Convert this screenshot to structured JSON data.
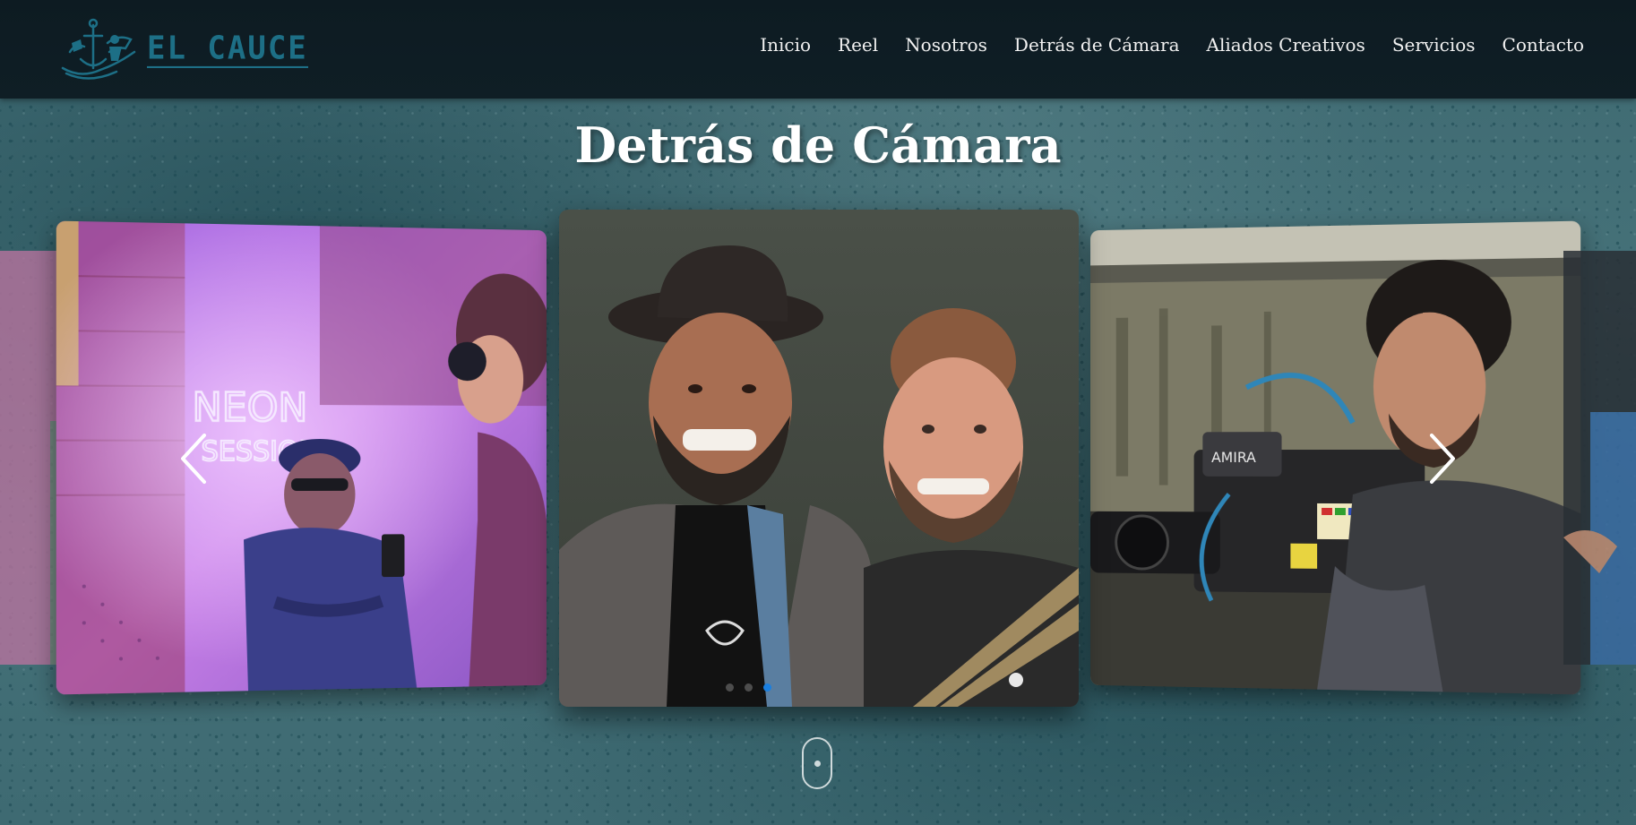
{
  "brand": {
    "name": "EL CAUCE",
    "logo_icon": "anchor-sailor-logo-icon"
  },
  "nav": {
    "items": [
      {
        "label": "Inicio"
      },
      {
        "label": "Reel"
      },
      {
        "label": "Nosotros"
      },
      {
        "label": "Detrás de Cámara"
      },
      {
        "label": "Aliados Creativos"
      },
      {
        "label": "Servicios"
      },
      {
        "label": "Contacto"
      }
    ]
  },
  "section": {
    "title": "Detrás de Cámara"
  },
  "carousel": {
    "slides": [
      {
        "name": "neon-sessions-photo",
        "neon_text_1": "NEON",
        "neon_text_2": "SESSIONS"
      },
      {
        "name": "two-men-smiling-photo"
      },
      {
        "name": "cameraman-photo",
        "camera_label": "AMIRA"
      }
    ],
    "dots_count": 3,
    "active_dot": 1,
    "prev_icon": "chevron-left-icon",
    "next_icon": "chevron-right-icon"
  },
  "colors": {
    "navbar_bg": "#0f1e25",
    "brand": "#1d6f86",
    "active_dot": "#1a7fe0",
    "page_bg": "#46737a"
  },
  "scroll_icon": "mouse-scroll-icon"
}
